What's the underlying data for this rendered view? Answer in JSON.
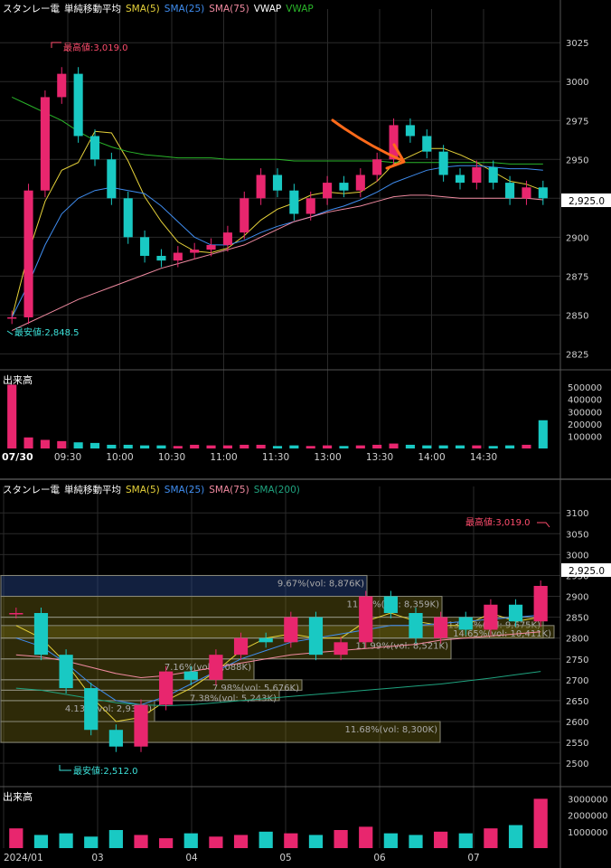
{
  "colors": {
    "background": "#000000",
    "grid": "#2a2a2a",
    "axis_text": "#d0d0d0",
    "up_candle": "#e8266e",
    "down_candle": "#19c9c3",
    "sma5": "#e6d23a",
    "sma25": "#3f8df0",
    "sma75": "#f08aa0",
    "sma200": "#1fa37f",
    "vwap": "#ffffff",
    "vwap2": "#2ab52a",
    "price_label_bg": "#ffffff",
    "high_label": "#ff4d6d",
    "low_label": "#3ce0d8",
    "annotation_arrow": "#ff6a1a"
  },
  "top_panel": {
    "legend": [
      {
        "text": "スタンレー電",
        "color": "#ffffff"
      },
      {
        "text": "単純移動平均",
        "color": "#ffffff"
      },
      {
        "text": "SMA(5)",
        "color": "#e6d23a"
      },
      {
        "text": "SMA(25)",
        "color": "#3f8df0"
      },
      {
        "text": "SMA(75)",
        "color": "#f08aa0"
      },
      {
        "text": "VWAP",
        "color": "#ffffff"
      },
      {
        "text": "VWAP",
        "color": "#2ab52a"
      }
    ],
    "high_label": "最高値:3,019.0",
    "low_label": "最安値:2,848.5",
    "current_price": "2,925.0",
    "volume_title": "出来高",
    "date_label": "07/30"
  },
  "bottom_panel": {
    "legend": [
      {
        "text": "スタンレー電",
        "color": "#ffffff"
      },
      {
        "text": "単純移動平均",
        "color": "#ffffff"
      },
      {
        "text": "SMA(5)",
        "color": "#e6d23a"
      },
      {
        "text": "SMA(25)",
        "color": "#3f8df0"
      },
      {
        "text": "SMA(75)",
        "color": "#f08aa0"
      },
      {
        "text": "SMA(200)",
        "color": "#1fa37f"
      }
    ],
    "high_label": "最高値:3,019.0",
    "low_label": "最安値:2,512.0",
    "current_price": "2,925.0",
    "volume_title": "出来高"
  },
  "chart_data": [
    {
      "type": "candlestick",
      "panel": "intraday",
      "x_labels": [
        "09:30",
        "10:00",
        "10:30",
        "11:00",
        "11:30",
        "13:00",
        "13:30",
        "14:00",
        "14:30"
      ],
      "y_ticks": [
        2825,
        2850,
        2875,
        2900,
        2925,
        2950,
        2975,
        3000,
        3025
      ],
      "ylim": [
        2820,
        3035
      ],
      "series": [
        {
          "name": "close",
          "values": [
            2848.5,
            2930,
            2990,
            3005,
            2965,
            2950,
            2925,
            2900,
            2888,
            2885,
            2890,
            2892,
            2895,
            2903,
            2925,
            2940,
            2930,
            2915,
            2925,
            2935,
            2930,
            2940,
            2950,
            2972,
            2965,
            2955,
            2940,
            2935,
            2945,
            2935,
            2925,
            2932,
            2925
          ]
        },
        {
          "name": "SMA(5)",
          "values": [
            2848.5,
            2890,
            2923,
            2943,
            2948,
            2968,
            2967,
            2949,
            2926,
            2910,
            2897,
            2891,
            2890,
            2893,
            2901,
            2911,
            2918,
            2922,
            2927,
            2929,
            2928,
            2929,
            2936,
            2947,
            2952,
            2957,
            2957,
            2953,
            2948,
            2942,
            2936,
            2934,
            2930
          ]
        },
        {
          "name": "SMA(25)",
          "values": [
            2848.5,
            2870,
            2895,
            2915,
            2925,
            2930,
            2932,
            2930,
            2928,
            2920,
            2910,
            2900,
            2895,
            2895,
            2898,
            2903,
            2907,
            2910,
            2913,
            2917,
            2920,
            2924,
            2929,
            2935,
            2939,
            2943,
            2945,
            2946,
            2946,
            2945,
            2944,
            2944,
            2943
          ]
        },
        {
          "name": "SMA(75)",
          "values": [
            2840,
            2845,
            2850,
            2855,
            2860,
            2864,
            2868,
            2872,
            2876,
            2880,
            2883,
            2886,
            2889,
            2892,
            2895,
            2900,
            2905,
            2910,
            2913,
            2916,
            2918,
            2920,
            2923,
            2926,
            2927,
            2927,
            2926,
            2925,
            2925,
            2925,
            2925,
            2925,
            2924
          ]
        },
        {
          "name": "VWAP",
          "values": [
            2990,
            2985,
            2980,
            2975,
            2968,
            2962,
            2958,
            2955,
            2953,
            2952,
            2951,
            2951,
            2951,
            2950,
            2950,
            2950,
            2950,
            2949,
            2949,
            2949,
            2949,
            2949,
            2949,
            2948,
            2948,
            2948,
            2948,
            2948,
            2948,
            2948,
            2947,
            2947,
            2947
          ]
        }
      ],
      "volume": {
        "title": "出来高",
        "y_ticks": [
          100000,
          200000,
          300000,
          400000,
          500000
        ],
        "ylim": [
          0,
          560000
        ],
        "values": [
          520000,
          90000,
          70000,
          60000,
          50000,
          45000,
          30000,
          30000,
          25000,
          25000,
          20000,
          30000,
          25000,
          25000,
          30000,
          30000,
          20000,
          25000,
          20000,
          25000,
          20000,
          25000,
          30000,
          40000,
          30000,
          25000,
          25000,
          25000,
          25000,
          20000,
          25000,
          30000,
          230000
        ]
      }
    },
    {
      "type": "candlestick",
      "panel": "daily",
      "x_labels": [
        "2024/01",
        "03",
        "04",
        "05",
        "06",
        "07"
      ],
      "y_ticks": [
        2500,
        2550,
        2600,
        2650,
        2700,
        2750,
        2800,
        2850,
        2900,
        2950,
        3000,
        3050,
        3100
      ],
      "ylim": [
        2470,
        3120
      ],
      "series": [
        {
          "name": "close",
          "values": [
            2860,
            2760,
            2680,
            2580,
            2540,
            2640,
            2720,
            2700,
            2760,
            2800,
            2790,
            2850,
            2760,
            2790,
            2900,
            2860,
            2800,
            2850,
            2820,
            2880,
            2840,
            2925
          ]
        },
        {
          "name": "SMA(5)",
          "values": [
            2830,
            2800,
            2740,
            2660,
            2600,
            2610,
            2650,
            2680,
            2720,
            2770,
            2800,
            2810,
            2800,
            2800,
            2840,
            2860,
            2840,
            2830,
            2830,
            2860,
            2840,
            2850
          ]
        },
        {
          "name": "SMA(25)",
          "values": [
            2800,
            2780,
            2740,
            2690,
            2650,
            2640,
            2660,
            2690,
            2720,
            2750,
            2770,
            2790,
            2800,
            2810,
            2820,
            2830,
            2830,
            2835,
            2840,
            2845,
            2850,
            2855
          ]
        },
        {
          "name": "SMA(75)",
          "values": [
            2760,
            2755,
            2745,
            2730,
            2715,
            2705,
            2710,
            2720,
            2730,
            2740,
            2750,
            2760,
            2765,
            2770,
            2775,
            2780,
            2785,
            2795,
            2800,
            2805,
            2810,
            2815
          ]
        },
        {
          "name": "SMA(200)",
          "values": [
            2680,
            2675,
            2665,
            2655,
            2645,
            2640,
            2638,
            2640,
            2645,
            2650,
            2655,
            2660,
            2665,
            2670,
            2675,
            2680,
            2685,
            2690,
            2697,
            2704,
            2712,
            2720
          ]
        }
      ],
      "volume_profile": [
        {
          "label": "9.67%(vol: 8,876K)",
          "low": 2900,
          "high": 2950
        },
        {
          "label": "11.74%(vol: 8,359K)",
          "low": 2850,
          "high": 2900
        },
        {
          "label": "13.61%(vol: 9,675K)",
          "low": 2800,
          "high": 2850
        },
        {
          "label": "14.65%(vol: 10,411K)",
          "low": 2800,
          "high": 2830
        },
        {
          "label": "11.99%(vol: 8,521K)",
          "low": 2750,
          "high": 2800
        },
        {
          "label": "7.16%(vol: 5,088K)",
          "low": 2700,
          "high": 2750
        },
        {
          "label": "7.98%(vol: 5,676K)",
          "low": 2675,
          "high": 2700
        },
        {
          "label": "7.38%(vol: 5,243K)",
          "low": 2650,
          "high": 2675
        },
        {
          "label": "4.13%(vol: 2,935K)",
          "low": 2600,
          "high": 2650
        },
        {
          "label": "11.68%(vol: 8,300K)",
          "low": 2550,
          "high": 2600
        }
      ],
      "volume": {
        "title": "出来高",
        "y_ticks": [
          1000000,
          2000000,
          3000000
        ],
        "ylim": [
          0,
          3300000
        ],
        "values": [
          1200000,
          800000,
          900000,
          700000,
          1100000,
          800000,
          600000,
          900000,
          700000,
          800000,
          1000000,
          900000,
          800000,
          1100000,
          1300000,
          900000,
          800000,
          1000000,
          900000,
          1200000,
          1400000,
          3000000
        ]
      }
    }
  ]
}
